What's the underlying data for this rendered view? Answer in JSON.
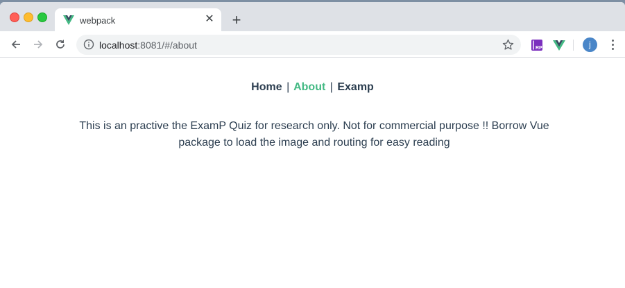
{
  "browser": {
    "tab": {
      "title": "webpack",
      "favicon": "vue-logo-icon",
      "close_icon": "close-icon"
    },
    "new_tab_icon": "plus-icon",
    "toolbar": {
      "back_icon": "arrow-left-icon",
      "forward_icon": "arrow-right-icon",
      "reload_icon": "reload-icon",
      "info_icon": "info-icon",
      "url_host": "localhost",
      "url_rest": ":8081/#/about",
      "bookmark_icon": "star-icon",
      "extensions": [
        {
          "name": "rp-extension-icon",
          "label": "RP",
          "color": "#7b2fbe"
        },
        {
          "name": "vue-devtools-icon",
          "color": "#42b983"
        }
      ],
      "avatar_letter": "j",
      "avatar_color": "#4a86c8",
      "menu_icon": "more-vertical-icon"
    }
  },
  "page": {
    "nav": [
      {
        "label": "Home",
        "active": false
      },
      {
        "label": "About",
        "active": true
      },
      {
        "label": "Examp",
        "active": false
      }
    ],
    "nav_separator": "|",
    "paragraph": "This is an practive the ExamP Quiz for research only. Not for commercial purpose !! Borrow Vue package to load the image and routing for easy reading"
  },
  "colors": {
    "accent": "#42b983",
    "text": "#2c3e50"
  }
}
